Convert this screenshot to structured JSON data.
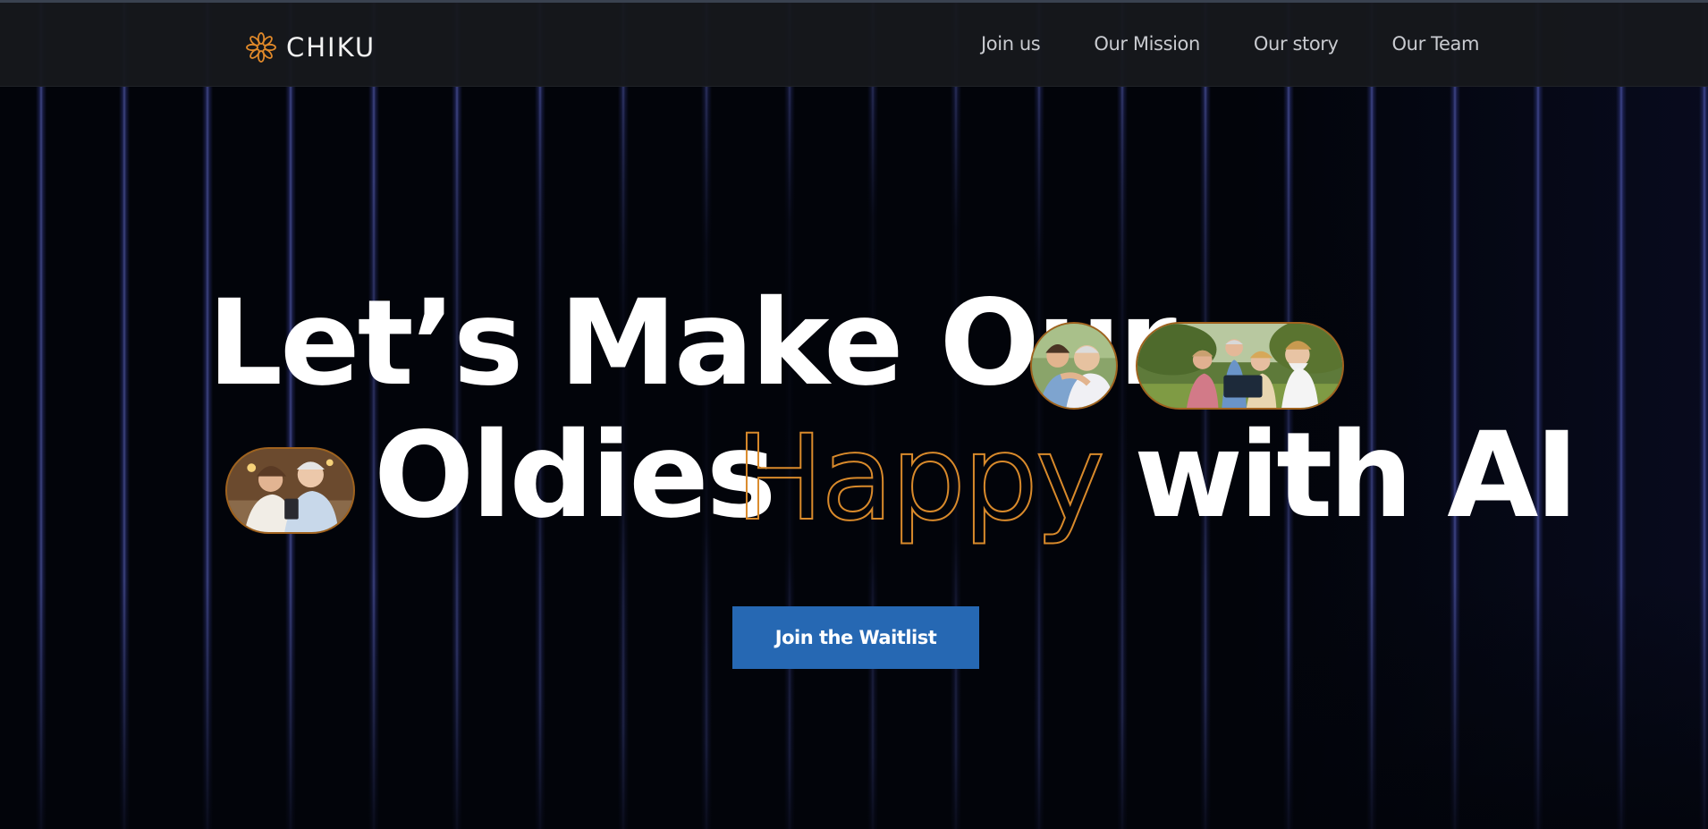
{
  "brand": {
    "name": "CHIKU",
    "logo_icon": "flower-burst-icon",
    "accent_color": "#e0892a"
  },
  "nav": {
    "items": [
      {
        "label": "Join us"
      },
      {
        "label": "Our Mission"
      },
      {
        "label": "Our story"
      },
      {
        "label": "Our Team"
      }
    ]
  },
  "hero": {
    "line1": "Let’s Make Our",
    "line2_start": "Oldies",
    "line2_outline": "Happy",
    "line2_end": "with AI",
    "outline_color": "#d98a2b",
    "images": [
      {
        "name": "couple-photo",
        "shape": "circle"
      },
      {
        "name": "group-selfie-photo",
        "shape": "pill"
      },
      {
        "name": "couple-phone-photo",
        "shape": "pill"
      }
    ]
  },
  "cta": {
    "label": "Join the Waitlist",
    "color": "#2668b3"
  },
  "theme": {
    "background": "#02040a",
    "stripe_color": "#5a64d8",
    "navbar_bg": "#16181c"
  }
}
